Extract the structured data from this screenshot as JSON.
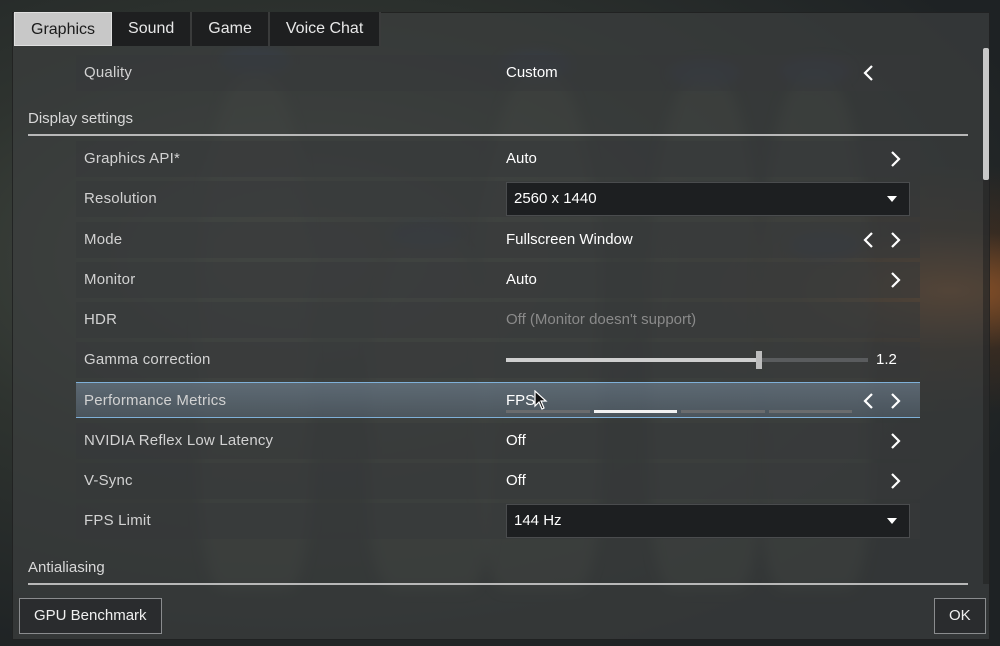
{
  "tabs": [
    "Graphics",
    "Sound",
    "Game",
    "Voice Chat"
  ],
  "active_tab": "Graphics",
  "quality": {
    "label": "Quality",
    "value": "Custom"
  },
  "sections": {
    "display": "Display settings",
    "antialiasing": "Antialiasing"
  },
  "settings": {
    "graphics_api": {
      "label": "Graphics API*",
      "value": "Auto"
    },
    "resolution": {
      "label": "Resolution",
      "value": "2560 x 1440"
    },
    "mode": {
      "label": "Mode",
      "value": "Fullscreen Window"
    },
    "monitor": {
      "label": "Monitor",
      "value": "Auto"
    },
    "hdr": {
      "label": "HDR",
      "value": "Off (Monitor doesn't support)"
    },
    "gamma": {
      "label": "Gamma correction",
      "value": "1.2",
      "fraction": 0.7
    },
    "performance_metrics": {
      "label": "Performance Metrics",
      "value": "FPS",
      "segments": 4,
      "selected_segment": 2
    },
    "nvidia_reflex": {
      "label": "NVIDIA Reflex Low Latency",
      "value": "Off"
    },
    "vsync": {
      "label": "V-Sync",
      "value": "Off"
    },
    "fps_limit": {
      "label": "FPS Limit",
      "value": "144 Hz"
    }
  },
  "footer": {
    "benchmark_label": "GPU Benchmark",
    "ok_label": "OK"
  },
  "icons": {
    "prev": "chevron-left-icon",
    "next": "chevron-right-icon",
    "dropdown": "caret-down-icon"
  },
  "colors": {
    "highlight_border": "#7fb0d8",
    "tab_active_bg": "#c8c8c8"
  }
}
